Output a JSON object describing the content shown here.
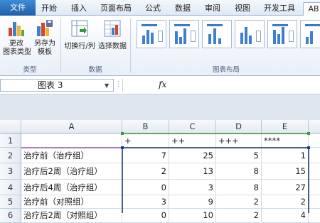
{
  "tabs": [
    "文件",
    "开始",
    "插入",
    "页面布局",
    "公式",
    "数据",
    "审阅",
    "视图",
    "开发工具",
    "AB"
  ],
  "ribbon": {
    "type_group": {
      "label": "类型",
      "change_type": [
        "更改",
        "图表类型"
      ],
      "save_template": [
        "另存为",
        "模板"
      ]
    },
    "data_group": {
      "label": "数据",
      "switch_row_col": "切换行/列",
      "select_data": "选择数据"
    },
    "layout_group": {
      "label": "图表布局"
    }
  },
  "formula_bar": {
    "name_box": "图表 3",
    "fx": "fx"
  },
  "sheet": {
    "columns": [
      "A",
      "B",
      "C",
      "D",
      "E"
    ],
    "rows": [
      {
        "num": "1",
        "a": "",
        "b": "+",
        "c": "++",
        "d": "+++",
        "e": "****"
      },
      {
        "num": "2",
        "a": "治疗前（治疗组）",
        "b": "7",
        "c": "25",
        "d": "5",
        "e": "1"
      },
      {
        "num": "3",
        "a": "治疗后2周（治疗组）",
        "b": "2",
        "c": "13",
        "d": "8",
        "e": "15"
      },
      {
        "num": "4",
        "a": "治疗后4周（治疗组）",
        "b": "0",
        "c": "3",
        "d": "8",
        "e": "27"
      },
      {
        "num": "5",
        "a": "治疗前（对照组）",
        "b": "3",
        "c": "9",
        "d": "2",
        "e": "2"
      },
      {
        "num": "6",
        "a": "治疗后2周（对照组）",
        "b": "0",
        "c": "10",
        "d": "2",
        "e": "4"
      }
    ]
  },
  "colors": {
    "file_tab": "#2a6ebb",
    "selection_border": "#1f3b7a",
    "chart_purple": "#9b59b6",
    "chart_green": "#3a9a3a"
  }
}
